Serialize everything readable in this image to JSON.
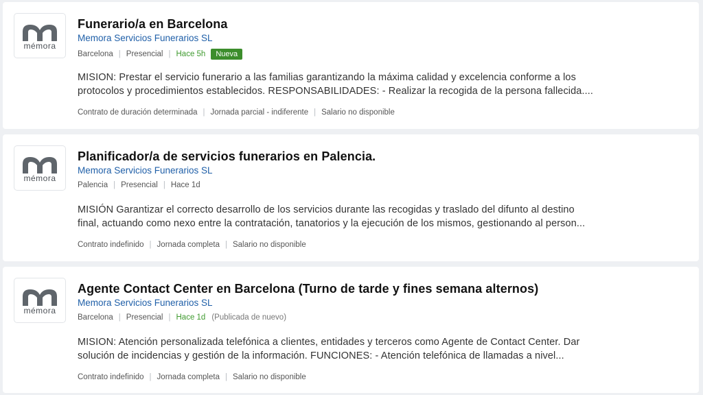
{
  "offers": [
    {
      "title": "Funerario/a en Barcelona",
      "company": "Memora Servicios Funerarios SL",
      "logo_text": "mémora",
      "city": "Barcelona",
      "modality": "Presencial",
      "posted": "Hace 5h",
      "badge": "Nueva",
      "republished": "",
      "desc_line1": "MISION: Prestar el servicio funerario a las familias garantizando la máxima calidad y excelencia conforme a los",
      "desc_line2": "protocolos y procedimientos establecidos. RESPONSABILIDADES: - Realizar la recogida de la persona fallecida....",
      "contract": "Contrato de duración determinada",
      "schedule": "Jornada parcial - indiferente",
      "salary": "Salario no disponible"
    },
    {
      "title": "Planificador/a de servicios funerarios en Palencia.",
      "company": "Memora Servicios Funerarios SL",
      "logo_text": "mémora",
      "city": "Palencia",
      "modality": "Presencial",
      "posted": "Hace 1d",
      "badge": "",
      "republished": "",
      "desc_line1": "MISIÓN Garantizar el correcto desarrollo de los servicios durante las recogidas y traslado del difunto al destino",
      "desc_line2": "final, actuando como nexo entre la contratación, tanatorios y la ejecución de los mismos, gestionando al person...",
      "contract": "Contrato indefinido",
      "schedule": "Jornada completa",
      "salary": "Salario no disponible"
    },
    {
      "title": "Agente Contact Center en Barcelona (Turno de tarde y fines semana alternos)",
      "company": "Memora Servicios Funerarios SL",
      "logo_text": "mémora",
      "city": "Barcelona",
      "modality": "Presencial",
      "posted": "Hace 1d",
      "badge": "",
      "republished": "(Publicada de nuevo)",
      "desc_line1": "MISION: Atención personalizada telefónica a clientes, entidades y terceros como Agente de Contact Center. Dar",
      "desc_line2": "solución de incidencias y gestión de la información. FUNCIONES: - Atención telefónica de llamadas a nivel...",
      "contract": "Contrato indefinido",
      "schedule": "Jornada completa",
      "salary": "Salario no disponible"
    }
  ],
  "colors": {
    "link": "#1f5fa8",
    "new_green": "#3f9a2f",
    "badge_bg": "#3c8d2c",
    "logo_gray": "#5f656b"
  }
}
